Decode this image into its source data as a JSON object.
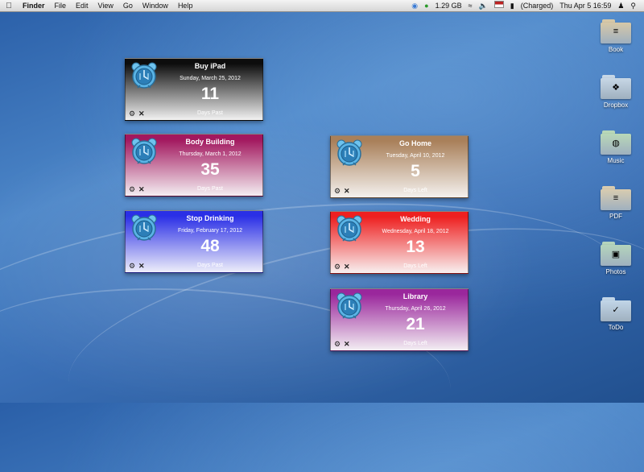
{
  "menubar": {
    "apple_icon": "apple-logo-icon",
    "items": [
      "Finder",
      "File",
      "Edit",
      "View",
      "Go",
      "Window",
      "Help"
    ],
    "memory": "1.29 GB",
    "battery_status": "(Charged)",
    "clock": "Thu Apr 5  16:59"
  },
  "widgets": [
    {
      "title": "Buy iPad",
      "date": "Sunday, March 25, 2012",
      "count": "11",
      "status": "Days Past",
      "gradient_top": "#0d0d0d",
      "gradient_bottom": "#f2f2f2"
    },
    {
      "title": "Body Building",
      "date": "Thursday, March 1, 2012",
      "count": "35",
      "status": "Days Past",
      "gradient_top": "#a2175e",
      "gradient_bottom": "#f4eef2"
    },
    {
      "title": "Stop Drinking",
      "date": "Friday, February 17, 2012",
      "count": "48",
      "status": "Days Past",
      "gradient_top": "#2a2fe6",
      "gradient_bottom": "#eeeefa"
    },
    {
      "title": "Go Home",
      "date": "Tuesday, April 10, 2012",
      "count": "5",
      "status": "Days Left",
      "gradient_top": "#a9805a",
      "gradient_bottom": "#f4f1ee"
    },
    {
      "title": "Wedding",
      "date": "Wednesday, April 18, 2012",
      "count": "13",
      "status": "Days Left",
      "gradient_top": "#ee2020",
      "gradient_bottom": "#f8f0f0"
    },
    {
      "title": "Library",
      "date": "Thursday, April 26, 2012",
      "count": "21",
      "status": "Days Left",
      "gradient_top": "#9a279c",
      "gradient_bottom": "#f3eef3"
    }
  ],
  "folders": [
    {
      "label": "Book",
      "color": "#d6c8a8",
      "icon": "book-icon",
      "glyph": "≡"
    },
    {
      "label": "Dropbox",
      "color": "#c7d7e6",
      "icon": "dropbox-icon",
      "glyph": "❖"
    },
    {
      "label": "Music",
      "color": "#b8d8b8",
      "icon": "music-icon",
      "glyph": "◍"
    },
    {
      "label": "PDF",
      "color": "#d8ccb0",
      "icon": "pdf-icon",
      "glyph": "≡"
    },
    {
      "label": "Photos",
      "color": "#b4d4bc",
      "icon": "camera-icon",
      "glyph": "▣"
    },
    {
      "label": "ToDo",
      "color": "#c2d6e8",
      "icon": "checkmark-icon",
      "glyph": "✓"
    }
  ]
}
